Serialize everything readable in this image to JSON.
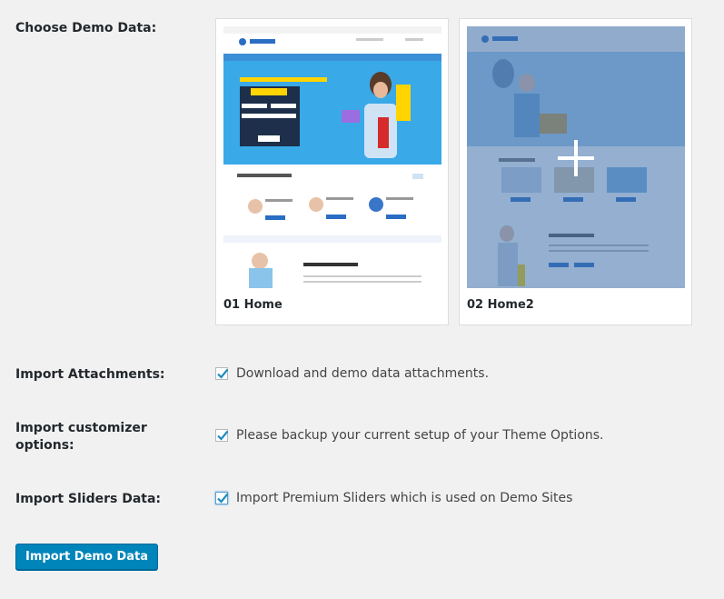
{
  "choose_demo": {
    "label": "Choose Demo Data:",
    "demos": [
      {
        "caption": "01 Home",
        "selected": false
      },
      {
        "caption": "02 Home2",
        "selected": true
      }
    ]
  },
  "options": [
    {
      "label": "Import Attachments:",
      "text": "Download and demo data attachments.",
      "checked": true
    },
    {
      "label": "Import customizer options:",
      "text": "Please backup your current setup of your Theme Options.",
      "checked": true
    },
    {
      "label": "Import Sliders Data:",
      "text": "Import Premium Sliders which is used on Demo Sites",
      "checked": true
    }
  ],
  "import_button": {
    "label": "Import Demo Data"
  },
  "colors": {
    "primary_button": "#0085ba",
    "checkmark": "#1e8cbe",
    "background": "#f1f1f1"
  },
  "icons": {
    "check": "checkmark-icon",
    "plus": "plus-icon"
  }
}
